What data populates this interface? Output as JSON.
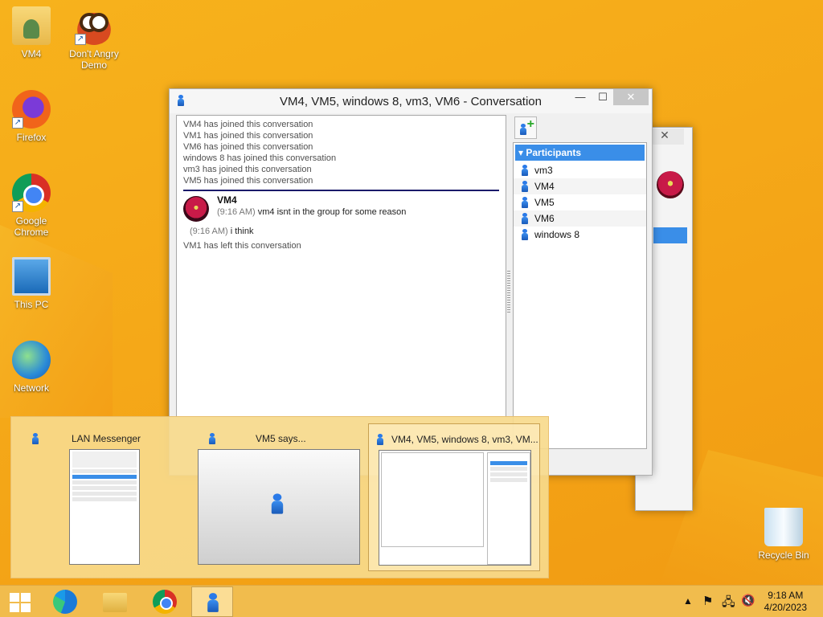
{
  "desktop": {
    "icons": [
      {
        "label": "VM4",
        "icon": "user-folder-icon"
      },
      {
        "label": "Don't Angry Demo",
        "icon": "angry-bird-icon"
      },
      {
        "label": "Firefox",
        "icon": "firefox-icon"
      },
      {
        "label": "Google Chrome",
        "icon": "chrome-icon"
      },
      {
        "label": "This PC",
        "icon": "computer-icon"
      },
      {
        "label": "Network",
        "icon": "network-icon"
      },
      {
        "label": "Recycle Bin",
        "icon": "recycle-bin-icon"
      }
    ]
  },
  "conversation": {
    "title": "VM4, VM5, windows 8, vm3, VM6 - Conversation",
    "minimize": "—",
    "maximize": "☐",
    "close": "✕",
    "system_messages": [
      "VM4 has joined this conversation",
      "VM1 has joined this conversation",
      "VM6 has joined this conversation",
      "windows 8 has joined this conversation",
      "vm3 has joined this conversation",
      "VM5 has joined this conversation"
    ],
    "message": {
      "sender": "VM4",
      "lines": [
        {
          "time": "(9:16 AM)",
          "text": "vm4 isnt in the group for some reason"
        },
        {
          "time": "(9:16 AM)",
          "text": "i think"
        }
      ]
    },
    "left_message": "VM1 has left this conversation",
    "participants_header": "Participants",
    "participants": [
      "vm3",
      "VM4",
      "VM5",
      "VM6",
      "windows 8"
    ]
  },
  "thumbnails": [
    {
      "title": "LAN Messenger"
    },
    {
      "title": "VM5 says..."
    },
    {
      "title": "VM4, VM5, windows 8, vm3, VM..."
    }
  ],
  "taskbar": {
    "time": "9:18 AM",
    "date": "4/20/2023"
  }
}
